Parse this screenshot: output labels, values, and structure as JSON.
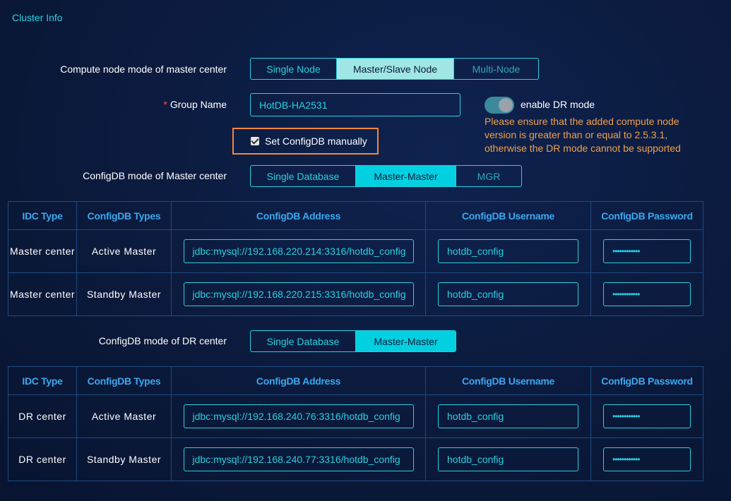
{
  "section_title": "Cluster Info",
  "compute_mode": {
    "label": "Compute node mode of master center",
    "options": [
      "Single Node",
      "Master/Slave Node",
      "Multi-Node"
    ],
    "selected": "Master/Slave Node"
  },
  "group_name": {
    "label": "Group Name",
    "required_mark": "*",
    "value": "HotDB-HA2531"
  },
  "dr_mode": {
    "label": "enable DR mode",
    "enabled": true,
    "warning": "Please ensure that the added compute node version is greater than or equal to 2.5.3.1, otherwise the DR mode cannot be supported"
  },
  "set_configdb": {
    "label": "Set ConfigDB manually",
    "checked": true
  },
  "master_configdb_mode": {
    "label": "ConfigDB mode of Master center",
    "options": [
      "Single Database",
      "Master-Master",
      "MGR"
    ],
    "selected": "Master-Master"
  },
  "dr_configdb_mode": {
    "label": "ConfigDB mode of DR center",
    "options": [
      "Single Database",
      "Master-Master"
    ],
    "selected": "Master-Master"
  },
  "table_headers": [
    "IDC Type",
    "ConfigDB Types",
    "ConfigDB Address",
    "ConfigDB Username",
    "ConfigDB Password"
  ],
  "master_rows": [
    {
      "idc": "Master center",
      "type": "Active Master",
      "address": "jdbc:mysql://192.168.220.214:3316/hotdb_config",
      "username": "hotdb_config",
      "password": "••••••••••••"
    },
    {
      "idc": "Master center",
      "type": "Standby Master",
      "address": "jdbc:mysql://192.168.220.215:3316/hotdb_config",
      "username": "hotdb_config",
      "password": "••••••••••••"
    }
  ],
  "dr_rows": [
    {
      "idc": "DR center",
      "type": "Active Master",
      "address": "jdbc:mysql://192.168.240.76:3316/hotdb_config",
      "username": "hotdb_config",
      "password": "••••••••••••"
    },
    {
      "idc": "DR center",
      "type": "Standby Master",
      "address": "jdbc:mysql://192.168.240.77:3316/hotdb_config",
      "username": "hotdb_config",
      "password": "••••••••••••"
    }
  ]
}
